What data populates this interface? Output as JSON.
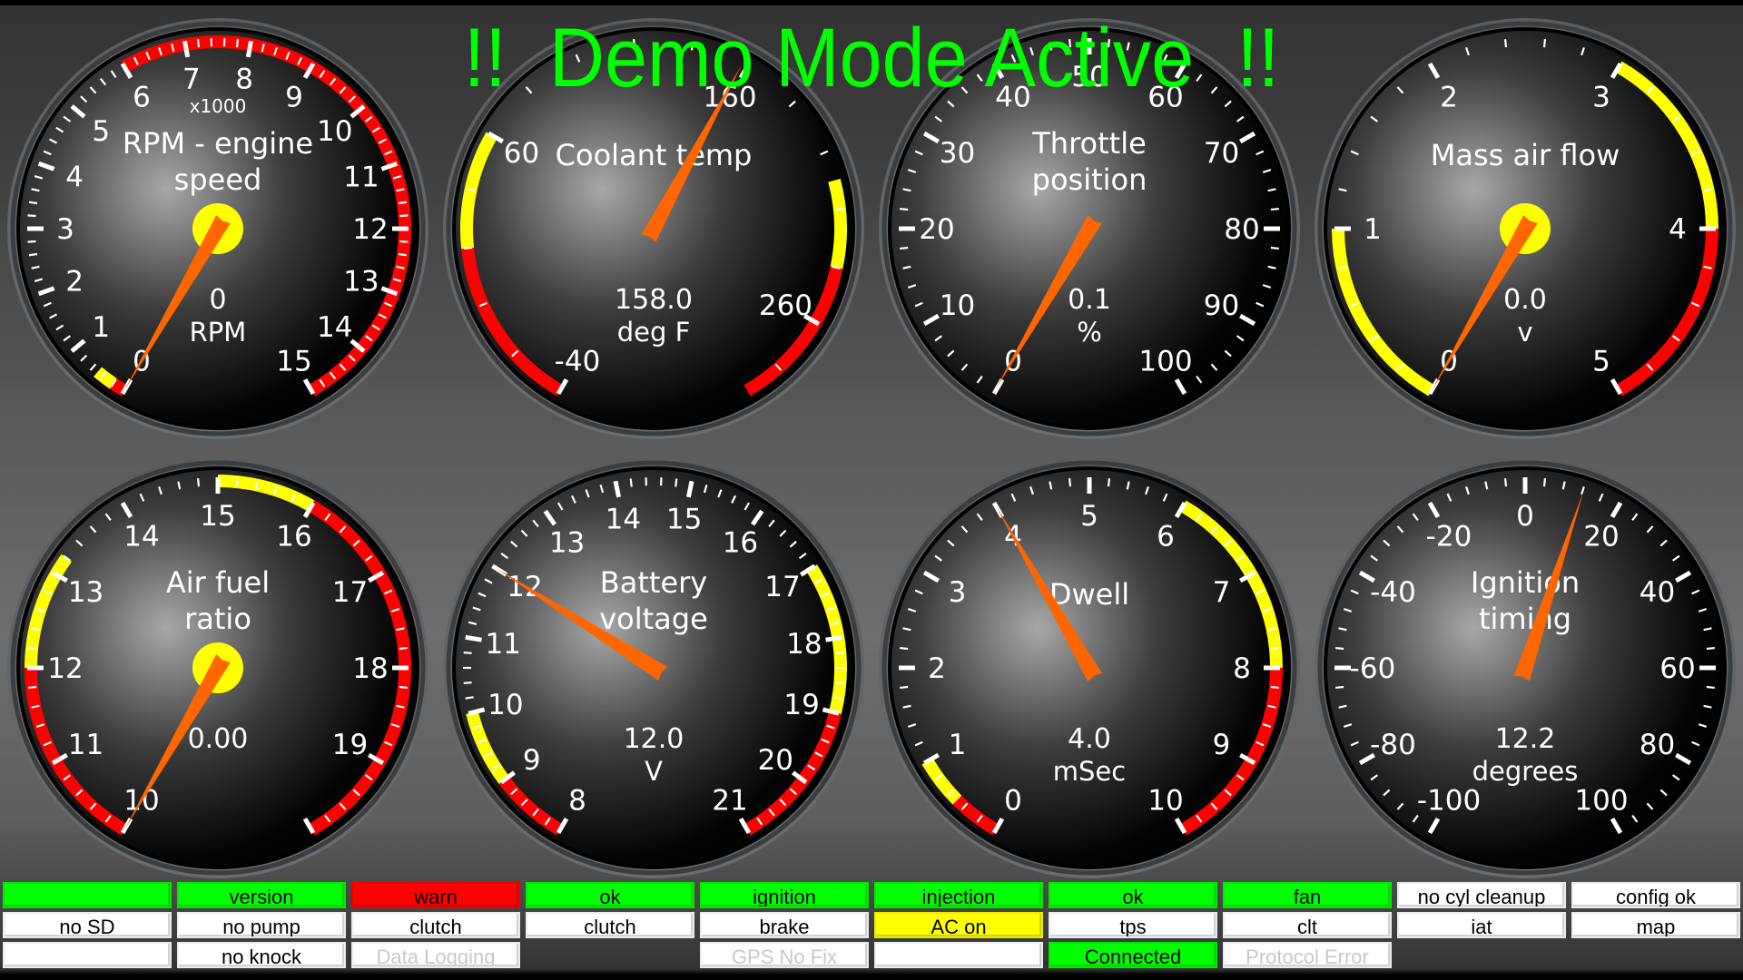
{
  "banner": "!!  Demo Mode Active  !!",
  "colors": {
    "banner": "#00ff00",
    "needle": "#ff6600",
    "zone_red": "#ff0000",
    "zone_yellow": "#ffff00",
    "status_green": "#00ff00",
    "status_red": "#ff0000",
    "status_yellow": "#ffff00",
    "status_white": "#ffffff"
  },
  "gauges": [
    {
      "id": "rpm",
      "title": [
        "RPM - engine",
        "speed"
      ],
      "multiplier": "x1000",
      "value": 0,
      "value_text": "0",
      "units": "RPM",
      "min": 0,
      "max": 15,
      "major_step": 1,
      "minor_per_major": 5,
      "labels": [
        0,
        1,
        2,
        3,
        4,
        5,
        6,
        7,
        8,
        9,
        10,
        11,
        12,
        13,
        14,
        15
      ],
      "hub": true,
      "zones": [
        {
          "from": 0,
          "to": 0.2,
          "color": "red"
        },
        {
          "from": 0.2,
          "to": 0.5,
          "color": "yellow"
        },
        {
          "from": 6,
          "to": 15,
          "color": "red"
        }
      ]
    },
    {
      "id": "coolant",
      "title": [
        "Coolant temp"
      ],
      "value": 158.0,
      "value_text": "158.0",
      "units": "deg F",
      "min": -40,
      "max": 293.3,
      "major_step": 100,
      "minor_per_major": 5,
      "labels": [
        -40,
        60,
        160,
        260
      ],
      "hub": false,
      "zones": [
        {
          "from": -40,
          "to": 20,
          "color": "red"
        },
        {
          "from": 20,
          "to": 60,
          "color": "yellow"
        },
        {
          "from": 210,
          "to": 240,
          "color": "yellow"
        },
        {
          "from": 240,
          "to": 293.3,
          "color": "red"
        }
      ]
    },
    {
      "id": "tps",
      "title": [
        "Throttle",
        "position"
      ],
      "value": 0.1,
      "value_text": "0.1",
      "units": "%",
      "min": 0,
      "max": 100,
      "major_step": 10,
      "minor_per_major": 5,
      "labels": [
        0,
        10,
        20,
        30,
        40,
        50,
        60,
        70,
        80,
        90,
        100
      ],
      "hub": false,
      "zones": []
    },
    {
      "id": "maf",
      "title": [
        "Mass air flow"
      ],
      "value": 0.0,
      "value_text": "0.0",
      "units": "v",
      "min": 0,
      "max": 5,
      "major_step": 1,
      "minor_per_major": 5,
      "labels": [
        0,
        1,
        2,
        3,
        4,
        5
      ],
      "hub": true,
      "zones": [
        {
          "from": 0,
          "to": 1,
          "color": "yellow"
        },
        {
          "from": 3,
          "to": 4,
          "color": "yellow"
        },
        {
          "from": 4,
          "to": 5,
          "color": "red"
        }
      ]
    },
    {
      "id": "afr",
      "title": [
        "Air fuel",
        "ratio"
      ],
      "value": 0.0,
      "value_text": "0.00",
      "units": "",
      "min": 10,
      "max": 20,
      "major_step": 1,
      "minor_per_major": 5,
      "labels": [
        10,
        11,
        12,
        13,
        14,
        15,
        16,
        17,
        18,
        19
      ],
      "hub": true,
      "zones": [
        {
          "from": 10,
          "to": 12,
          "color": "red"
        },
        {
          "from": 12,
          "to": 13.2,
          "color": "yellow"
        },
        {
          "from": 15,
          "to": 16,
          "color": "yellow"
        },
        {
          "from": 16,
          "to": 20,
          "color": "red"
        }
      ]
    },
    {
      "id": "vbatt",
      "title": [
        "Battery",
        "voltage"
      ],
      "value": 12.0,
      "value_text": "12.0",
      "units": "V",
      "min": 8,
      "max": 21,
      "major_step": 1,
      "minor_per_major": 5,
      "labels": [
        8,
        9,
        10,
        11,
        12,
        13,
        14,
        15,
        16,
        17,
        18,
        19,
        20,
        21
      ],
      "hub": false,
      "zones": [
        {
          "from": 8,
          "to": 9,
          "color": "red"
        },
        {
          "from": 9,
          "to": 10,
          "color": "yellow"
        },
        {
          "from": 17,
          "to": 19,
          "color": "yellow"
        },
        {
          "from": 19,
          "to": 21,
          "color": "red"
        }
      ]
    },
    {
      "id": "dwell",
      "title": [
        "Dwell"
      ],
      "value": 4.0,
      "value_text": "4.0",
      "units": "mSec",
      "min": 0,
      "max": 10,
      "major_step": 1,
      "minor_per_major": 5,
      "labels": [
        0,
        1,
        2,
        3,
        4,
        5,
        6,
        7,
        8,
        9,
        10
      ],
      "hub": false,
      "zones": [
        {
          "from": 0,
          "to": 0.5,
          "color": "red"
        },
        {
          "from": 0.5,
          "to": 1,
          "color": "yellow"
        },
        {
          "from": 6,
          "to": 8,
          "color": "yellow"
        },
        {
          "from": 8,
          "to": 10,
          "color": "red"
        }
      ]
    },
    {
      "id": "timing",
      "title": [
        "Ignition",
        "timing"
      ],
      "value": 12.2,
      "value_text": "12.2",
      "units": "degrees",
      "min": -100,
      "max": 100,
      "major_step": 20,
      "minor_per_major": 5,
      "labels": [
        -100,
        -80,
        -60,
        -40,
        -20,
        0,
        20,
        40,
        60,
        80,
        100
      ],
      "hub": false,
      "zones": []
    }
  ],
  "status_rows": [
    [
      {
        "label": "",
        "color": "green"
      },
      {
        "label": "version",
        "color": "green"
      },
      {
        "label": "warn",
        "color": "red"
      },
      {
        "label": "ok",
        "color": "green"
      },
      {
        "label": "ignition",
        "color": "green"
      },
      {
        "label": "injection",
        "color": "green"
      },
      {
        "label": "ok",
        "color": "green"
      },
      {
        "label": "fan",
        "color": "green"
      },
      {
        "label": "no cyl cleanup",
        "color": "white"
      },
      {
        "label": "config ok",
        "color": "white"
      }
    ],
    [
      {
        "label": "no SD",
        "color": "white"
      },
      {
        "label": "no pump",
        "color": "white"
      },
      {
        "label": "clutch",
        "color": "white"
      },
      {
        "label": "clutch",
        "color": "white"
      },
      {
        "label": "brake",
        "color": "white"
      },
      {
        "label": "AC on",
        "color": "yellow"
      },
      {
        "label": "tps",
        "color": "white"
      },
      {
        "label": "clt",
        "color": "white"
      },
      {
        "label": "iat",
        "color": "white"
      },
      {
        "label": "map",
        "color": "white"
      }
    ],
    [
      {
        "label": "",
        "color": "white"
      },
      {
        "label": "no knock",
        "color": "white"
      },
      {
        "label": "Data Logging",
        "color": "white",
        "dim": true
      },
      null,
      {
        "label": "GPS No Fix",
        "color": "white",
        "dim": true
      },
      {
        "label": "",
        "color": "white"
      },
      {
        "label": "Connected",
        "color": "green"
      },
      {
        "label": "Protocol Error",
        "color": "white",
        "dim": true
      },
      null,
      null
    ]
  ]
}
